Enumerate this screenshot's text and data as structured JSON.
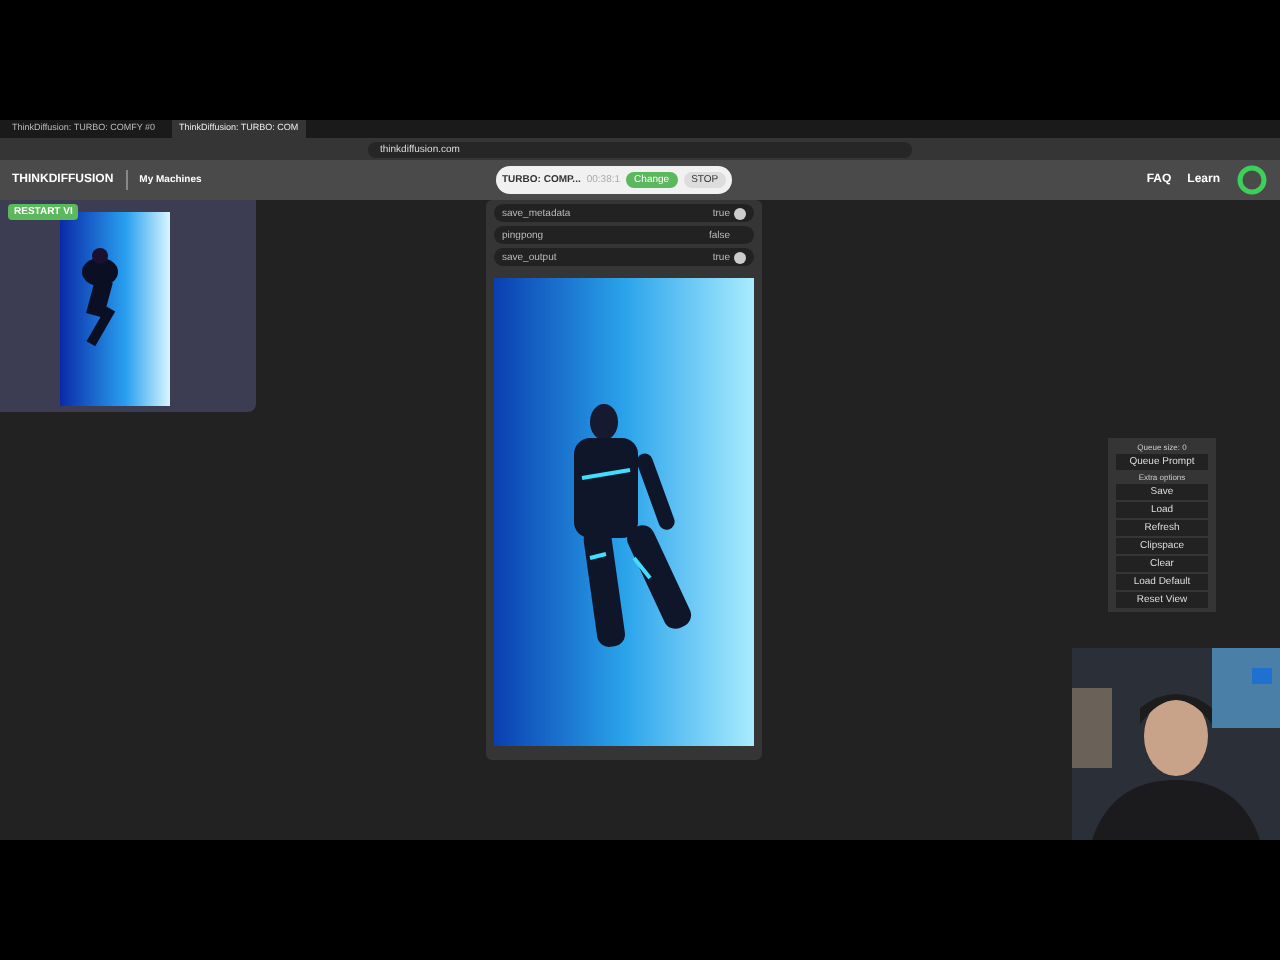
{
  "browser": {
    "tabs": [
      {
        "title": "ThinkDiffusion: TURBO: COMFY #0",
        "selected": false
      },
      {
        "title": "ThinkDiffusion: TURBO: COM",
        "selected": true
      }
    ],
    "address": "thinkdiffusion.com"
  },
  "header": {
    "logo": "THINKDIFFUSION",
    "nav": "My Machines",
    "machine": {
      "name": "TURBO: COMP...",
      "timer": "00:38:1",
      "change": "Change",
      "stop": "STOP"
    },
    "links": [
      "FAQ",
      "Learn"
    ]
  },
  "preview_node": {
    "badge": "RESTART VI"
  },
  "save_node": {
    "widgets": [
      {
        "name": "save_metadata",
        "value": "true",
        "on": true
      },
      {
        "name": "pingpong",
        "value": "false",
        "on": false
      },
      {
        "name": "save_output",
        "value": "true",
        "on": true
      }
    ]
  },
  "menu": {
    "queue_size": "Queue size: 0",
    "queue_button": "Queue Prompt",
    "extra_options": "Extra options",
    "buttons": [
      "Save",
      "Load",
      "Refresh",
      "Clipspace",
      "Clear",
      "Load Default",
      "Reset View"
    ]
  }
}
